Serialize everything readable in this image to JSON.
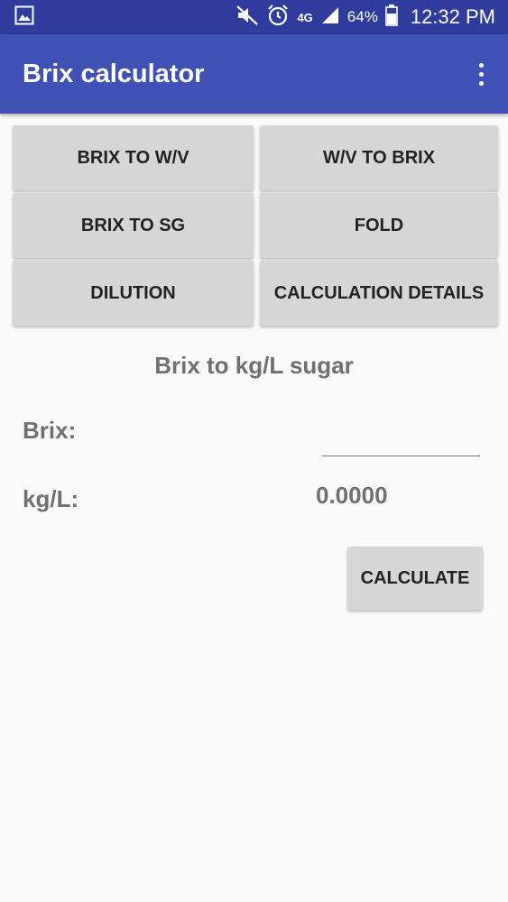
{
  "status_bar": {
    "battery_percent": "64%",
    "time": "12:32 PM",
    "network": "4G",
    "icons": [
      "gallery-icon",
      "mute-icon",
      "alarm-icon",
      "signal-icon",
      "battery-icon"
    ],
    "color": "#2f3c9d"
  },
  "app_bar": {
    "title": "Brix calculator",
    "color": "#3f51b5",
    "overflow_icon": "more-vert-icon"
  },
  "mode_buttons": [
    "BRIX TO W/V",
    "W/V TO BRIX",
    "BRIX TO SG",
    "FOLD",
    "DILUTION",
    "CALCULATION DETAILS"
  ],
  "form": {
    "title": "Brix to kg/L sugar",
    "brix_label": "Brix:",
    "brix_value": "",
    "result_label": "kg/L:",
    "result_value": "0.0000",
    "calculate_label": "CALCULATE"
  }
}
